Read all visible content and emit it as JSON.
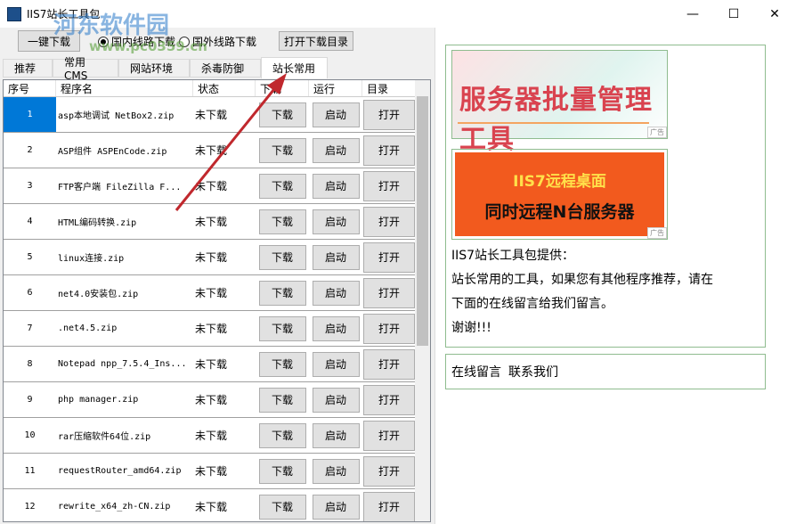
{
  "window": {
    "title": "IIS7站长工具包",
    "min": "—",
    "max": "☐",
    "close": "✕"
  },
  "watermark": {
    "name": "河东软件园",
    "url": "www.pc0359.cn"
  },
  "toolbar": {
    "one_click": "一键下载",
    "radio_domestic": "国内线路下载",
    "radio_foreign": "国外线路下载",
    "open_dir": "打开下载目录",
    "domestic_selected": true
  },
  "tabs": [
    {
      "label": "推荐"
    },
    {
      "label": "常用CMS"
    },
    {
      "label": "网站环境"
    },
    {
      "label": "杀毒防御"
    },
    {
      "label": "站长常用",
      "active": true
    }
  ],
  "table": {
    "headers": [
      "序号",
      "程序名",
      "状态",
      "下载",
      "运行",
      "目录"
    ],
    "rows": [
      {
        "no": "1",
        "name": "asp本地调试 NetBox2.zip",
        "status": "未下载",
        "dl": "下载",
        "run": "启动",
        "dir": "打开"
      },
      {
        "no": "2",
        "name": "ASP组件 ASPEnCode.zip",
        "status": "未下载",
        "dl": "下载",
        "run": "启动",
        "dir": "打开"
      },
      {
        "no": "3",
        "name": "FTP客户端 FileZilla F...",
        "status": "未下载",
        "dl": "下载",
        "run": "启动",
        "dir": "打开"
      },
      {
        "no": "4",
        "name": "HTML编码转换.zip",
        "status": "未下载",
        "dl": "下载",
        "run": "启动",
        "dir": "打开"
      },
      {
        "no": "5",
        "name": "linux连接.zip",
        "status": "未下载",
        "dl": "下载",
        "run": "启动",
        "dir": "打开"
      },
      {
        "no": "6",
        "name": "net4.0安装包.zip",
        "status": "未下载",
        "dl": "下载",
        "run": "启动",
        "dir": "打开"
      },
      {
        "no": "7",
        "name": ".net4.5.zip",
        "status": "未下载",
        "dl": "下载",
        "run": "启动",
        "dir": "打开"
      },
      {
        "no": "8",
        "name": "Notepad npp_7.5.4_Ins...",
        "status": "未下载",
        "dl": "下载",
        "run": "启动",
        "dir": "打开"
      },
      {
        "no": "9",
        "name": "php manager.zip",
        "status": "未下载",
        "dl": "下载",
        "run": "启动",
        "dir": "打开"
      },
      {
        "no": "10",
        "name": "rar压缩软件64位.zip",
        "status": "未下载",
        "dl": "下载",
        "run": "启动",
        "dir": "打开"
      },
      {
        "no": "11",
        "name": "requestRouter_amd64.zip",
        "status": "未下载",
        "dl": "下载",
        "run": "启动",
        "dir": "打开"
      },
      {
        "no": "12",
        "name": "rewrite_x64_zh-CN.zip",
        "status": "未下载",
        "dl": "下载",
        "run": "启动",
        "dir": "打开"
      }
    ]
  },
  "ads": [
    {
      "text": "服务器批量管理工具",
      "tag": "广告"
    },
    {
      "line1": "IIS7远程桌面",
      "line2": "同时远程N台服务器",
      "tag": "广告"
    }
  ],
  "info": {
    "l1": "IIS7站长工具包提供：",
    "l2": "站长常用的工具，如果您有其他程序推荐，请在",
    "l3": "下面的在线留言给我们留言。",
    "l4": "谢谢!!!"
  },
  "links": {
    "message": "在线留言",
    "contact": "联系我们"
  },
  "colors": {
    "selection": "#0078d7",
    "arrow": "#c0282d"
  }
}
